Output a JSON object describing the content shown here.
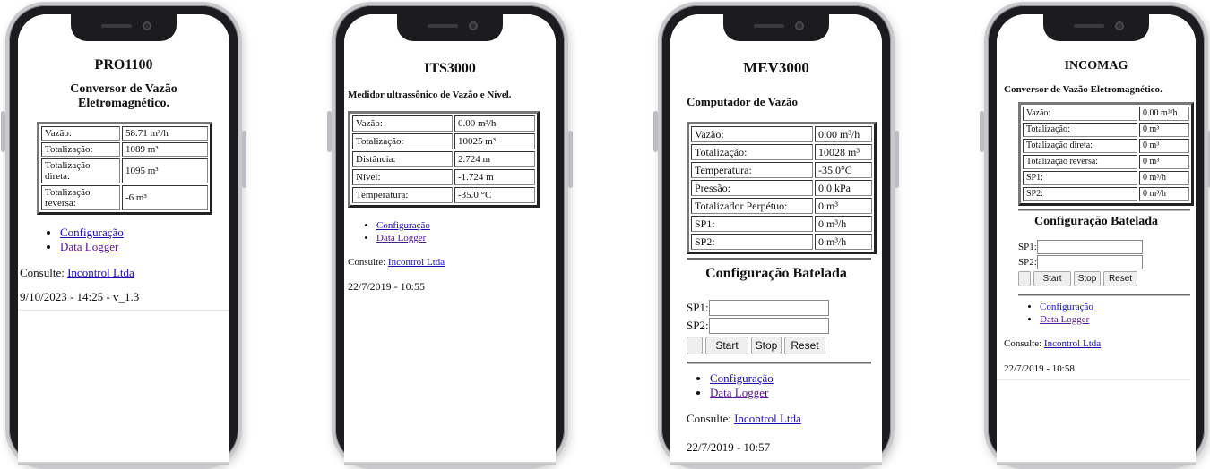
{
  "phones": [
    {
      "title": "PRO1100",
      "subtitle_line1": "Conversor de Vazão",
      "subtitle_line2": "Eletromagnético.",
      "rows": [
        [
          "Vazão:",
          "58.71 m³/h"
        ],
        [
          "Totalização:",
          "1089 m³"
        ],
        [
          "Totalização direta:",
          "1095 m³"
        ],
        [
          "Totalização reversa:",
          "-6 m³"
        ]
      ],
      "links": [
        "Configuração",
        "Data Logger"
      ],
      "consult_label": "Consulte:",
      "consult_link": "Incontrol Ltda",
      "footer": "9/10/2023 - 14:25 - v_1.3"
    },
    {
      "title": "ITS3000",
      "subtitle": "Medidor ultrassônico de Vazão e Nível.",
      "rows": [
        [
          "Vazão:",
          "0.00 m³/h"
        ],
        [
          "Totalização:",
          "10025 m³"
        ],
        [
          "Distância:",
          "2.724 m"
        ],
        [
          "Nível:",
          "-1.724 m"
        ],
        [
          "Temperatura:",
          "-35.0 °C"
        ]
      ],
      "links": [
        "Configuração",
        "Data Logger"
      ],
      "consult_label": "Consulte:",
      "consult_link": "Incontrol Ltda",
      "footer": "22/7/2019 - 10:55"
    },
    {
      "title": "MEV3000",
      "subtitle": "Computador de Vazão",
      "rows": [
        [
          "Vazão:",
          "0.00 m³/h"
        ],
        [
          "Totalização:",
          "10028 m³"
        ],
        [
          "Temperatura:",
          "-35.0°C"
        ],
        [
          "Pressão:",
          "0.0 kPa"
        ],
        [
          "Totalizador Perpétuo:",
          "0 m³"
        ],
        [
          "SP1:",
          "0 m³/h"
        ],
        [
          "SP2:",
          "0 m³/h"
        ]
      ],
      "batch_title": "Configuração Batelada",
      "sp1_label": "SP1:",
      "sp2_label": "SP2:",
      "buttons": [
        "Start",
        "Stop",
        "Reset"
      ],
      "links": [
        "Configuração",
        "Data Logger"
      ],
      "consult_label": "Consulte:",
      "consult_link": "Incontrol Ltda",
      "footer": "22/7/2019 - 10:57"
    },
    {
      "title": "INCOMAG",
      "subtitle": "Conversor de Vazão Eletromagnético.",
      "rows": [
        [
          "Vazão:",
          "0.00 m³/h"
        ],
        [
          "Totalização:",
          "0 m³"
        ],
        [
          "Totalização direta:",
          "0 m³"
        ],
        [
          "Totalização reversa:",
          "0 m³"
        ],
        [
          "SP1:",
          "0 m³/h"
        ],
        [
          "SP2:",
          "0 m³/h"
        ]
      ],
      "batch_title": "Configuração Batelada",
      "sp1_label": "SP1:",
      "sp2_label": "SP2:",
      "buttons": [
        "Start",
        "Stop",
        "Reset"
      ],
      "links": [
        "Configuração",
        "Data Logger"
      ],
      "consult_label": "Consulte:",
      "consult_link": "Incontrol Ltda",
      "footer": "22/7/2019 - 10:58"
    }
  ]
}
